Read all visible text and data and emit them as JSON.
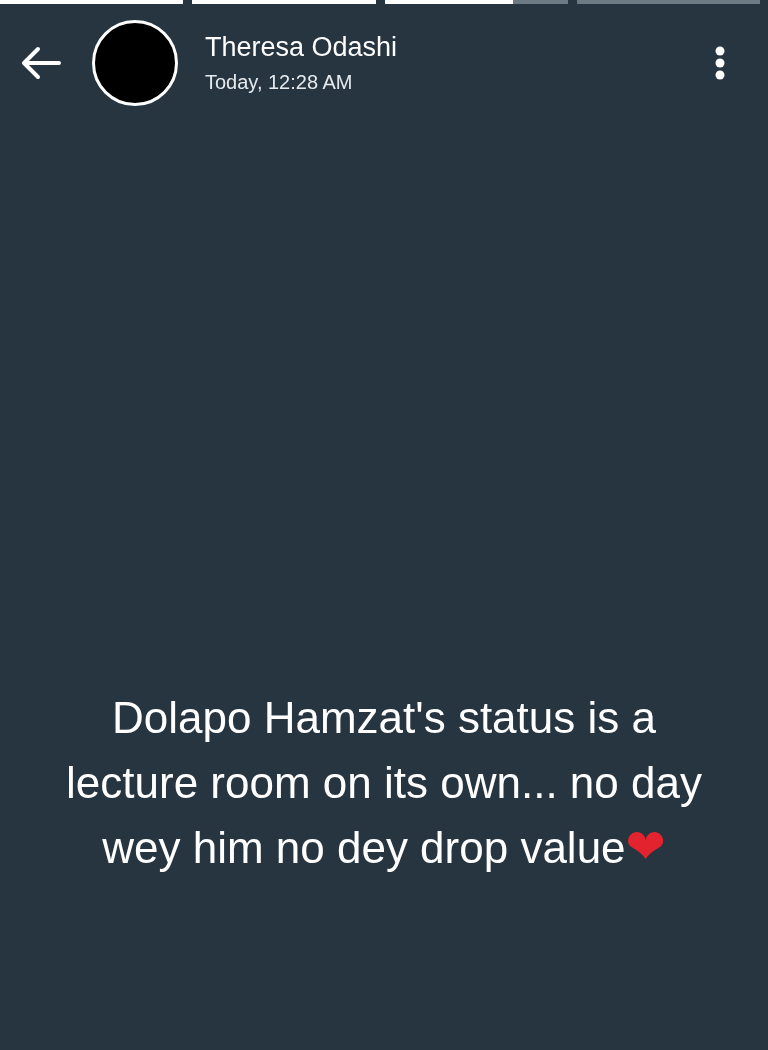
{
  "progress_segments": [
    {
      "level": 1
    },
    {
      "level": 1
    },
    {
      "level": 0.7
    },
    {
      "level": 0
    }
  ],
  "header": {
    "contact_name": "Theresa Odashi",
    "timestamp": "Today, 12:28 AM"
  },
  "status": {
    "text": "Dolapo Hamzat's status is a lecture room on its own... no day wey him no dey drop value",
    "emoji": "❤"
  }
}
